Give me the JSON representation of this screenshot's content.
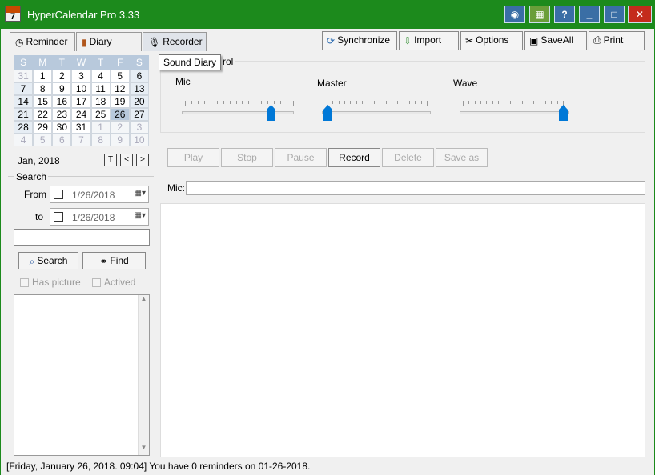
{
  "window": {
    "title": "HyperCalendar Pro 3.33",
    "app_icon_number": "7"
  },
  "tabs": [
    {
      "label": "Reminder",
      "icon": "clock-icon"
    },
    {
      "label": "Diary",
      "icon": "book-icon"
    },
    {
      "label": "Recorder",
      "icon": "microphone-icon",
      "active": true
    }
  ],
  "tooltip": "Sound Diary",
  "toolbar": {
    "synchronize": "Synchronize",
    "import": "Import",
    "options": "Options",
    "saveall": "SaveAll",
    "print": "Print"
  },
  "calendar": {
    "weekdays": [
      "S",
      "M",
      "T",
      "W",
      "T",
      "F",
      "S"
    ],
    "weeks": [
      [
        "31",
        "1",
        "2",
        "3",
        "4",
        "5",
        "6"
      ],
      [
        "7",
        "8",
        "9",
        "10",
        "11",
        "12",
        "13"
      ],
      [
        "14",
        "15",
        "16",
        "17",
        "18",
        "19",
        "20"
      ],
      [
        "21",
        "22",
        "23",
        "24",
        "25",
        "26",
        "27"
      ],
      [
        "28",
        "29",
        "30",
        "31",
        "1",
        "2",
        "3"
      ],
      [
        "4",
        "5",
        "6",
        "7",
        "8",
        "9",
        "10"
      ]
    ],
    "month_label": "Jan, 2018",
    "today_button": "T",
    "prev_button": "<",
    "next_button": ">"
  },
  "search": {
    "group_label": "Search",
    "from_label": "From",
    "to_label": "to",
    "from_date": "1/26/2018",
    "to_date": "1/26/2018",
    "search_button": "Search",
    "find_button": "Find",
    "has_picture": "Has picture",
    "actived": "Actived"
  },
  "volume": {
    "group_label_fragment": "rol",
    "mic_label": "Mic",
    "master_label": "Master",
    "wave_label": "Wave",
    "mic_level": 0.79,
    "master_level": 0.0,
    "wave_level": 1.0
  },
  "recorder": {
    "play": "Play",
    "stop": "Stop",
    "pause": "Pause",
    "record": "Record",
    "delete": "Delete",
    "save_as": "Save as",
    "mic_field_label": "Mic:"
  },
  "status": {
    "text": "[Friday, January 26, 2018. 09:04] You have 0 reminders on 01-26-2018."
  }
}
